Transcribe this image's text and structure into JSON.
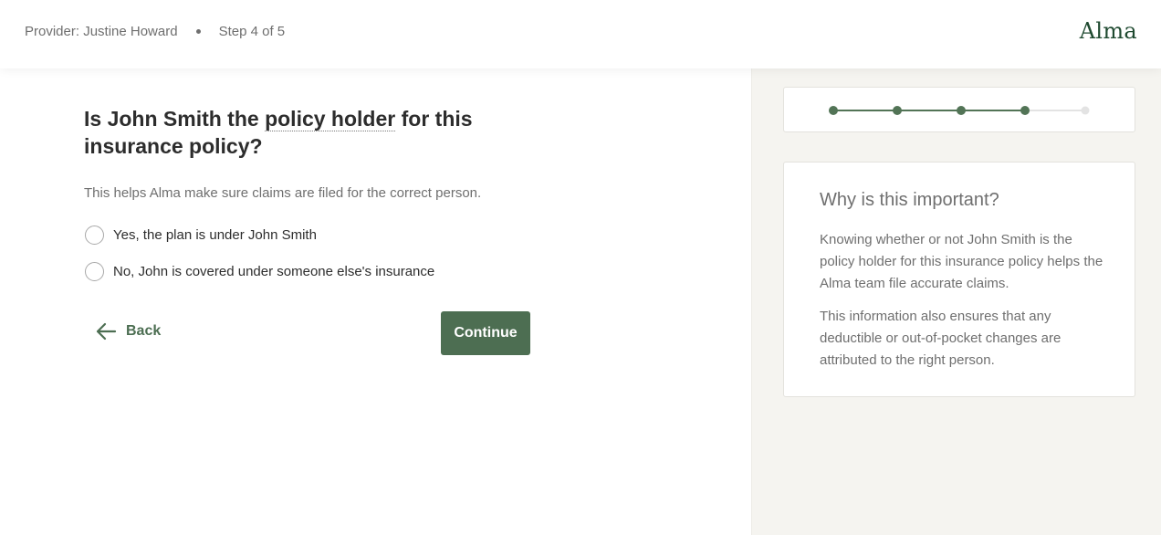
{
  "header": {
    "provider_text": "Provider: Justine Howard",
    "step_text": "Step 4 of 5",
    "logo_text": "Alma"
  },
  "question": {
    "prefix": "Is John Smith the ",
    "term": "policy holder",
    "suffix": " for this insurance policy?",
    "helper": "This helps Alma make sure claims are filed for the correct person."
  },
  "options": [
    {
      "label": "Yes, the plan is under John Smith",
      "selected": false
    },
    {
      "label": "No, John is covered under someone else's insurance",
      "selected": false
    }
  ],
  "nav": {
    "back_label": "Back",
    "continue_label": "Continue"
  },
  "progress": {
    "current_step": 4,
    "total_steps": 5
  },
  "info": {
    "title": "Why is this important?",
    "paragraph1": "Knowing whether or not John Smith is the policy holder for this insurance policy helps the Alma team file accurate claims.",
    "paragraph2": "This information also ensures that any deductible or out-of-pocket changes are attributed to the right person."
  },
  "colors": {
    "accent": "#4d6e52",
    "step_done": "#527456",
    "step_todo": "#e3e3e3",
    "sidebar_bg": "#f5f4f0",
    "logo": "#1f4a30"
  },
  "icons": {
    "back": "arrow-left-icon"
  }
}
